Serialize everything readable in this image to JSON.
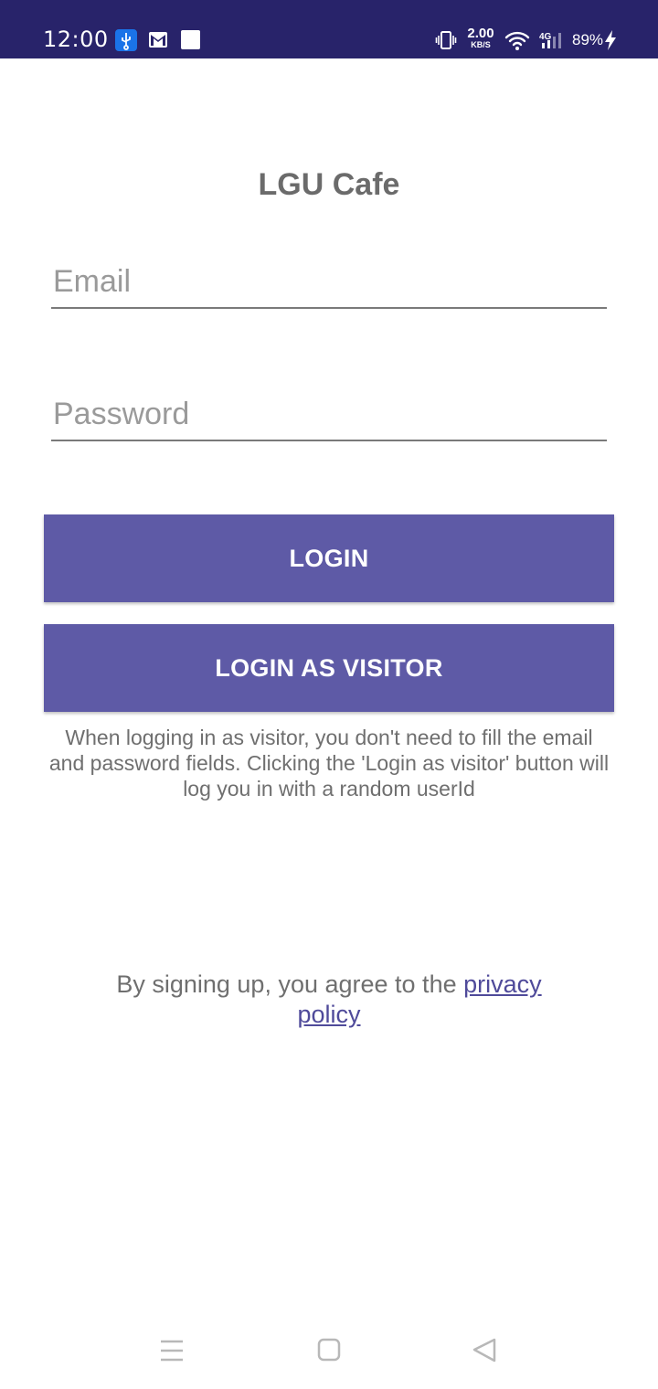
{
  "status_bar": {
    "time": "12:00",
    "net_speed_value": "2.00",
    "net_speed_unit": "KB/S",
    "signal_label": "4G",
    "battery": "89%",
    "icons": [
      "usb-icon",
      "gmail-icon",
      "notification-icon",
      "vibrate-icon",
      "wifi-icon",
      "cell-signal-icon",
      "charging-icon"
    ]
  },
  "login": {
    "title": "LGU Cafe",
    "email_placeholder": "Email",
    "password_placeholder": "Password",
    "login_button": "LOGIN",
    "visitor_button": "LOGIN AS VISITOR",
    "visitor_note": "When logging in as visitor, you don't need to fill the email and password fields. Clicking the 'Login as visitor' button will log you in with a random userId",
    "agree_prefix": "By signing up, you agree to the ",
    "privacy_link": "privacy policy"
  },
  "colors": {
    "status_bar": "#28236a",
    "accent": "#5e5aa6",
    "link": "#4f4a9a"
  },
  "nav_bar": {
    "icons": [
      "menu-icon",
      "home-icon",
      "back-icon"
    ]
  }
}
